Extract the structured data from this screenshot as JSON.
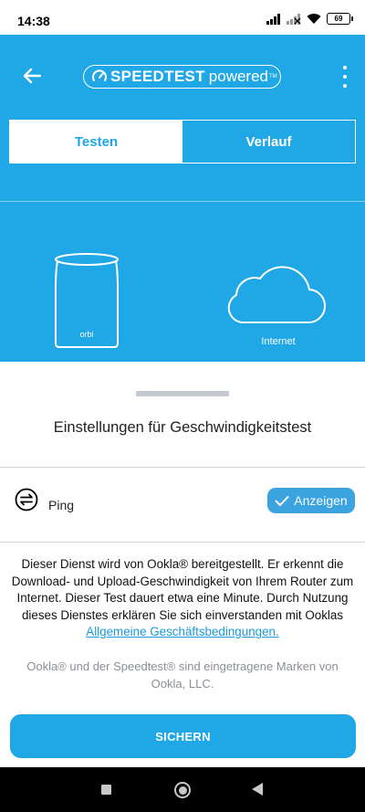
{
  "status_bar": {
    "time": "14:38",
    "battery": "69"
  },
  "header": {
    "logo_brand": "SPEEDTEST",
    "logo_powered": "powered",
    "logo_tm": "TM",
    "accent_color": "#1fa7e6"
  },
  "tabs": [
    {
      "label": "Testen",
      "active": true
    },
    {
      "label": "Verlauf",
      "active": false
    }
  ],
  "diagram": {
    "router_label": "orbi",
    "cloud_label": "Internet"
  },
  "settings": {
    "title": "Einstellungen für Geschwindigkeitstest",
    "ping_label": "Ping",
    "ping_toggle_label": "Anzeigen",
    "ping_toggle_checked": true
  },
  "info": {
    "text": "Dieser Dienst wird von Ookla® bereitgestellt. Er erkennt die Download- und Upload-Geschwindigkeit von Ihrem Router zum Internet. Dieser Test dauert etwa eine Minute. Durch Nutzung dieses Dienstes erklären Sie sich einverstanden mit Ooklas",
    "link_text": "Allgemeine Geschäftsbedingungen.",
    "trademark": "Ookla® und der Speedtest® sind eingetragene Marken von Ookla, LLC."
  },
  "save_button_label": "SICHERN",
  "icons": [
    "back-arrow-icon",
    "speedtest-gauge-icon",
    "more-vert-icon",
    "ping-icon",
    "check-icon",
    "router-icon",
    "cloud-icon",
    "signal-icon",
    "wifi-icon",
    "battery-icon"
  ]
}
